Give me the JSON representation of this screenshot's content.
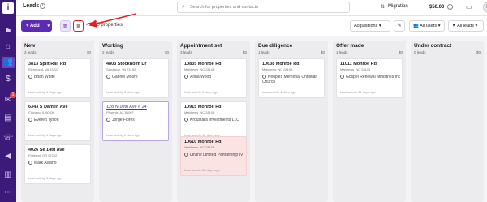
{
  "header": {
    "title": "Leads",
    "search_placeholder": "Search for properties and contacts",
    "migration_label": "Migration",
    "balance": "$50.00",
    "avatar_initial": "M"
  },
  "sidebar": {
    "logo": "i",
    "notification_count": "1"
  },
  "toolbar": {
    "add_label": "+ Add",
    "properties_count": "10 properties",
    "acquisitions_label": "Acquisitions",
    "all_users_label": "All users",
    "all_leads_label": "All leads",
    "annotation_color": "#e02020"
  },
  "columns": [
    {
      "title": "New",
      "sub": "3 leads",
      "sum": "$0",
      "cards": [
        {
          "addr": "3813 Split Rail Rd",
          "city": "Richmond, VA 23223",
          "owner": "Brian White",
          "activity": "Last activity 0 days ago"
        },
        {
          "addr": "6343 S Damen Ave",
          "city": "Chicago, IL 60636",
          "owner": "Everett Tyson",
          "activity": "Last activity 0 days ago"
        },
        {
          "addr": "4026 Se 14th Ave",
          "city": "Portland, OR 97202",
          "owner": "Mark Asiano",
          "activity": "Last activity 0 days ago"
        }
      ]
    },
    {
      "title": "Working",
      "sub": "2 leads",
      "sum": "$0",
      "cards": [
        {
          "addr": "4803 Stockholm Dr",
          "city": "Sandston, VA 23150",
          "owner": "Gabriel Moore",
          "activity": "Last activity 0 days ago"
        },
        {
          "addr": "128 N 10th Ave # 24",
          "city": "Phoenix, AZ 85007",
          "owner": "Jorge Flores",
          "activity": "Last activity 0 days ago"
        }
      ]
    },
    {
      "title": "Appointment set",
      "sub": "3 leads",
      "sum": "$0",
      "cards": [
        {
          "addr": "10835 Monroe Rd",
          "city": "Matthews, NC 28105",
          "owner": "Anna Wood",
          "activity": "Last activity 0 days ago"
        },
        {
          "addr": "10915 Monroe Rd",
          "city": "Matthews, NC 28105",
          "owner": "Kroustalis Investments LLC",
          "activity": "Last activity 40 days ago"
        },
        {
          "addr": "10610 Monroe Rd",
          "city": "Matthews, NC 28105",
          "owner": "Levine Limited Partnership IV",
          "activity": "Last activity 28 days ago"
        }
      ]
    },
    {
      "title": "Due diligence",
      "sub": "1 leads",
      "sum": "$0",
      "cards": [
        {
          "addr": "10638 Monroe Rd",
          "city": "Matthews, NC 28105",
          "owner": "Peoples Memorial Christian Church",
          "activity": "Last activity 4 days ago"
        }
      ]
    },
    {
      "title": "Offer made",
      "sub": "1 leads",
      "sum": "$0",
      "cards": [
        {
          "addr": "11011 Monroe Rd",
          "city": "Matthews, NC 28105",
          "owner": "Gospel Renewal Ministries Inc",
          "activity": "Last activity 34 days ago"
        }
      ]
    },
    {
      "title": "Under contract",
      "sub": "0 leads",
      "sum": "$0",
      "cards": []
    }
  ]
}
